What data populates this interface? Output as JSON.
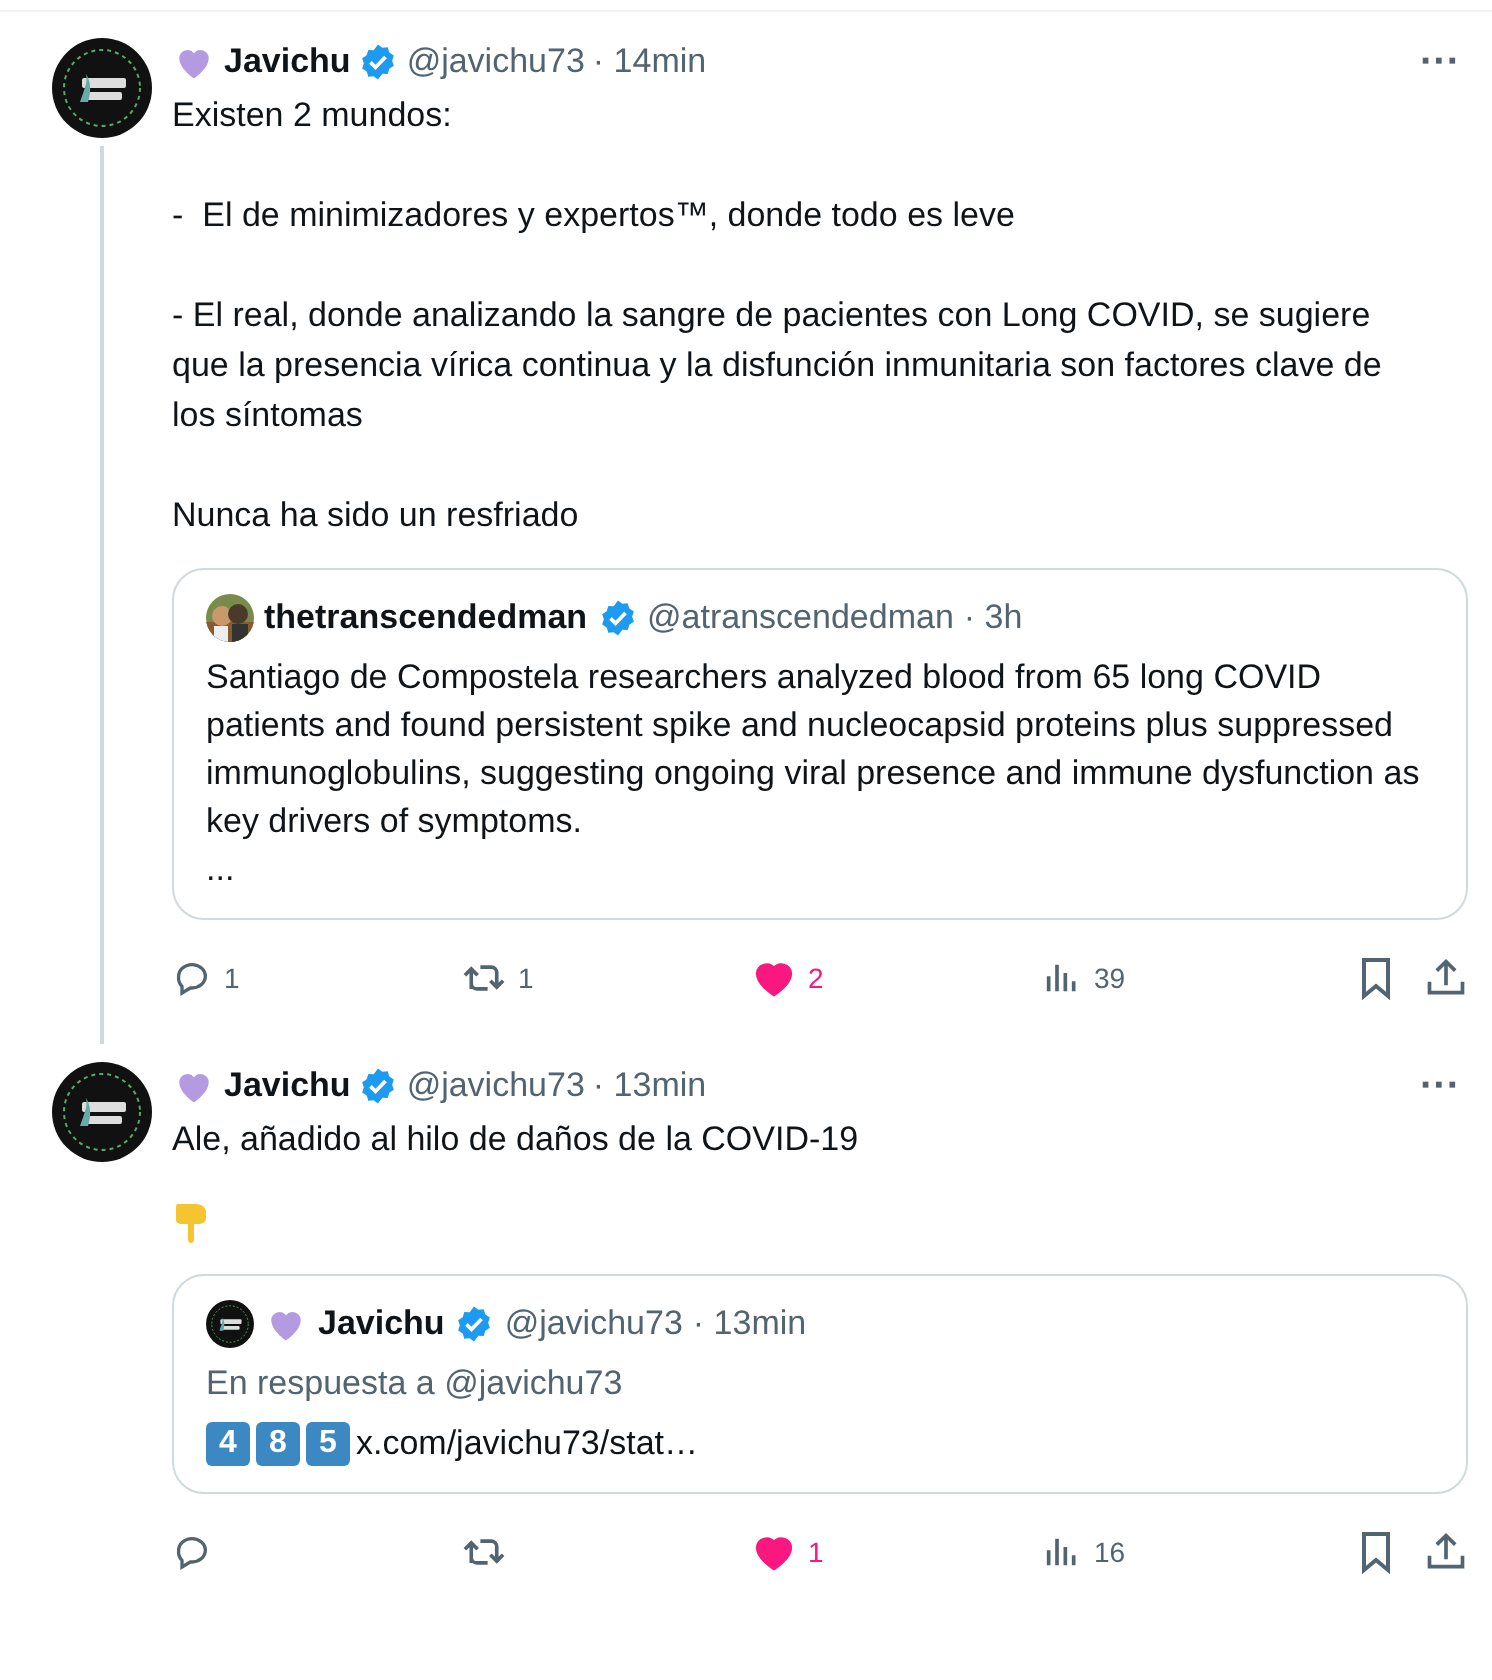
{
  "tweets": [
    {
      "author": {
        "name": "Javichu",
        "handle": "@javichu73",
        "time": "· 14min"
      },
      "more": "···",
      "text": "Existen 2 mundos:\n\n-  El de minimizadores y expertos™, donde todo es leve\n\n- El real, donde analizando la sangre de pacientes con Long COVID, se sugiere que la presencia vírica continua y la disfunción inmunitaria son factores clave de los síntomas\n\nNunca ha sido un resfriado",
      "thread_line": true,
      "pointing_emoji": false,
      "quote": {
        "author": {
          "name": "thetranscendedman",
          "handle": "@atranscendedman",
          "time": "· 3h",
          "heart": false
        },
        "text": "Santiago de Compostela researchers analyzed blood from 65 long COVID patients and found persistent spike and nucleocapsid proteins plus suppressed immunoglobulins, suggesting ongoing viral presence and immune dysfunction as key drivers of symptoms.\n..."
      },
      "actions": {
        "replies": "1",
        "reposts": "1",
        "likes": "2",
        "liked": true,
        "views": "39"
      }
    },
    {
      "author": {
        "name": "Javichu",
        "handle": "@javichu73",
        "time": "· 13min"
      },
      "more": "···",
      "text": "Ale, añadido al hilo de daños de la COVID-19",
      "thread_line": false,
      "pointing_emoji": true,
      "quote": {
        "kind": "logo",
        "author": {
          "name": "Javichu",
          "handle": "@javichu73",
          "time": "· 13min",
          "heart": true
        },
        "reply_to": "En respuesta a @javichu73",
        "keycaps": [
          "4",
          "8",
          "5"
        ],
        "text": "x.com/javichu73/stat…"
      },
      "actions": {
        "likes": "1",
        "liked": true,
        "views": "16"
      }
    }
  ]
}
